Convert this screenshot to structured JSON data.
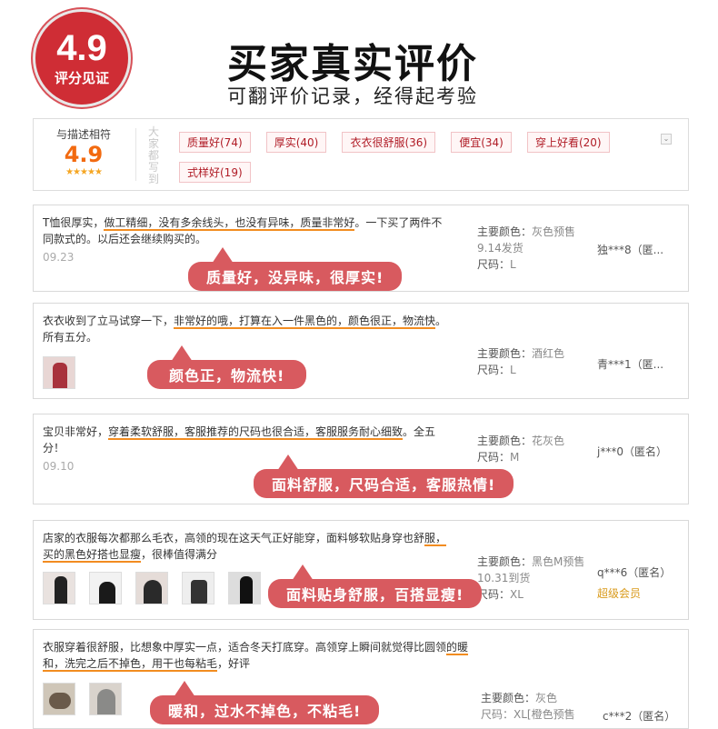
{
  "header": {
    "score": "4.9",
    "score_label": "评分见证",
    "title": "买家真实评价",
    "subtitle": "可翻评价记录，经得起考验"
  },
  "summary": {
    "match_label": "与描述相符",
    "match_score": "4.9",
    "stars": "★★★★★",
    "vertical_label": "大家都写到",
    "tags": [
      "质量好(74)",
      "厚实(40)",
      "衣衣很舒服(36)",
      "便宜(34)",
      "穿上好看(20)",
      "式样好(19)"
    ],
    "dropdown": "⌄"
  },
  "reviews": [
    {
      "text_pre": "T恤很厚实，",
      "text_hl": "做工精细，没有多余线头，也没有异味，质量非常好",
      "text_post": "。一下买了两件不同款式的。以后还会继续购买的。",
      "date": "09.23",
      "color_label": "主要颜色：",
      "color": "灰色预售",
      "extra": "9.14发货",
      "size_label": "尺码：",
      "size": "L",
      "user": "独***8（匿...",
      "bubble": "质量好，没异味，很厚实!"
    },
    {
      "text_pre": "衣衣收到了立马试穿一下，",
      "text_hl": "非常好的哦，打算在入一件黑色的，颜色很正，物流快",
      "text_post": "。所有五分。",
      "date": "",
      "color_label": "主要颜色：",
      "color": "酒红色",
      "extra": "",
      "size_label": "尺码：",
      "size": "L",
      "user": "青***1（匿...",
      "bubble": "颜色正，物流快!"
    },
    {
      "text_pre": "宝贝非常好，",
      "text_hl": "穿着柔软舒服，客服推荐的尺码也很合适，客服服务耐心细致",
      "text_post": "。全五分！",
      "date": "09.10",
      "color_label": "主要颜色：",
      "color": "花灰色",
      "extra": "",
      "size_label": "尺码：",
      "size": "M",
      "user": "j***0（匿名）",
      "bubble": "面料舒服，尺码合适，客服热情!"
    },
    {
      "text_pre": "店家的衣服每次都那么毛衣，高领的现在这天气正好能穿，面料够软贴身穿也舒",
      "text_hl": "服，买的黑色好搭也显瘦",
      "text_post": "，很棒值得满分",
      "date": "",
      "color_label": "主要颜色：",
      "color": "黑色M预售",
      "extra": "10.31到货",
      "size_label": "尺码：",
      "size": "XL",
      "user": "q***6（匿名）",
      "vip": "超级会员",
      "bubble": "面料贴身舒服，百搭显瘦!"
    },
    {
      "text_pre": "衣服穿着很舒服，比想象中厚实一点，适合冬天打底穿。高领穿上瞬间就觉得比圆领",
      "text_hl": "的暖和，洗完之后不掉色，用干也每粘毛",
      "text_post": "，好评",
      "date": "",
      "color_label": "主要颜色：",
      "color": "灰色",
      "extra": "尺码：XL[橙色预售",
      "size_label": "",
      "size": "",
      "user": "c***2（匿名）",
      "bubble": "暖和，过水不掉色，不粘毛!"
    }
  ]
}
